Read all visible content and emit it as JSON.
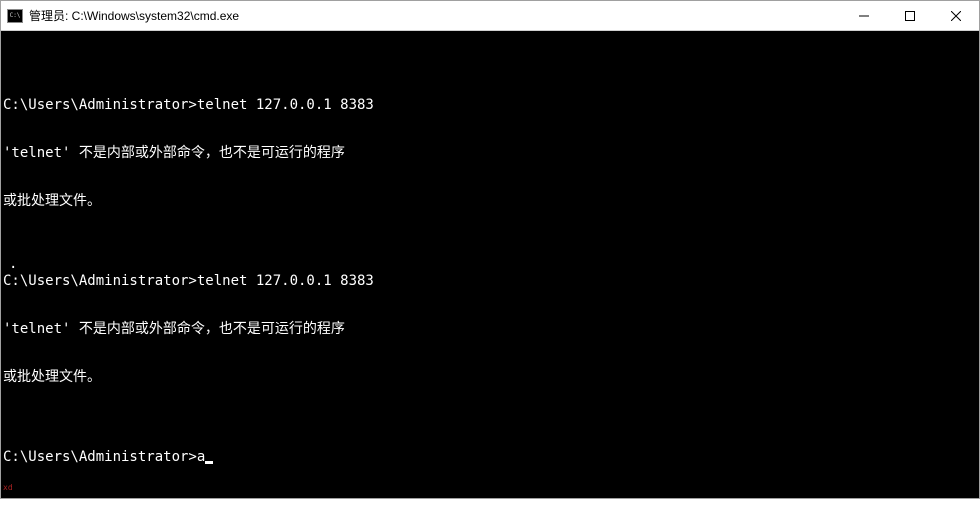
{
  "titlebar": {
    "title": "管理员: C:\\Windows\\system32\\cmd.exe"
  },
  "terminal": {
    "lines": [
      "",
      "C:\\Users\\Administrator>telnet 127.0.0.1 8383",
      "'telnet' 不是内部或外部命令，也不是可运行的程序",
      "或批处理文件。",
      "",
      "C:\\Users\\Administrator>telnet 127.0.0.1 8383",
      "'telnet' 不是内部或外部命令，也不是可运行的程序",
      "或批处理文件。",
      ""
    ],
    "current_prompt": "C:\\Users\\Administrator>",
    "current_input": "a"
  },
  "dot": ".",
  "red_marker": "xd"
}
